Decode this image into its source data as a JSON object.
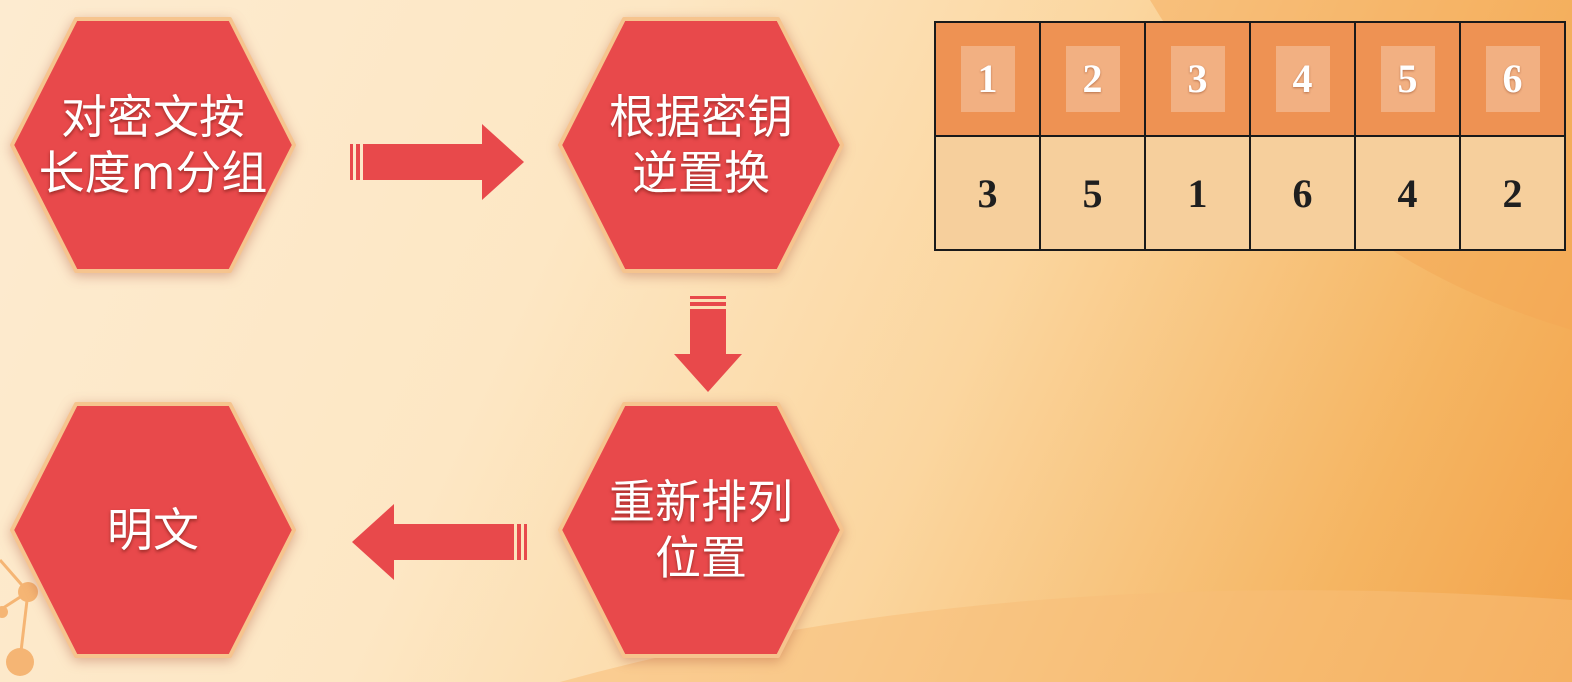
{
  "flow": {
    "step1": "对密文按\n长度m分组",
    "step2": "根据密钥\n逆置换",
    "step3": "重新排列\n位置",
    "step4": "明文"
  },
  "table": {
    "positions": [
      "1",
      "2",
      "3",
      "4",
      "5",
      "6"
    ],
    "key": [
      "3",
      "5",
      "1",
      "6",
      "4",
      "2"
    ]
  },
  "colors": {
    "hexagon": "#e8494b",
    "arrow": "#e8494b",
    "table_header": "#ee9253",
    "table_body": "#f6cf9c"
  }
}
